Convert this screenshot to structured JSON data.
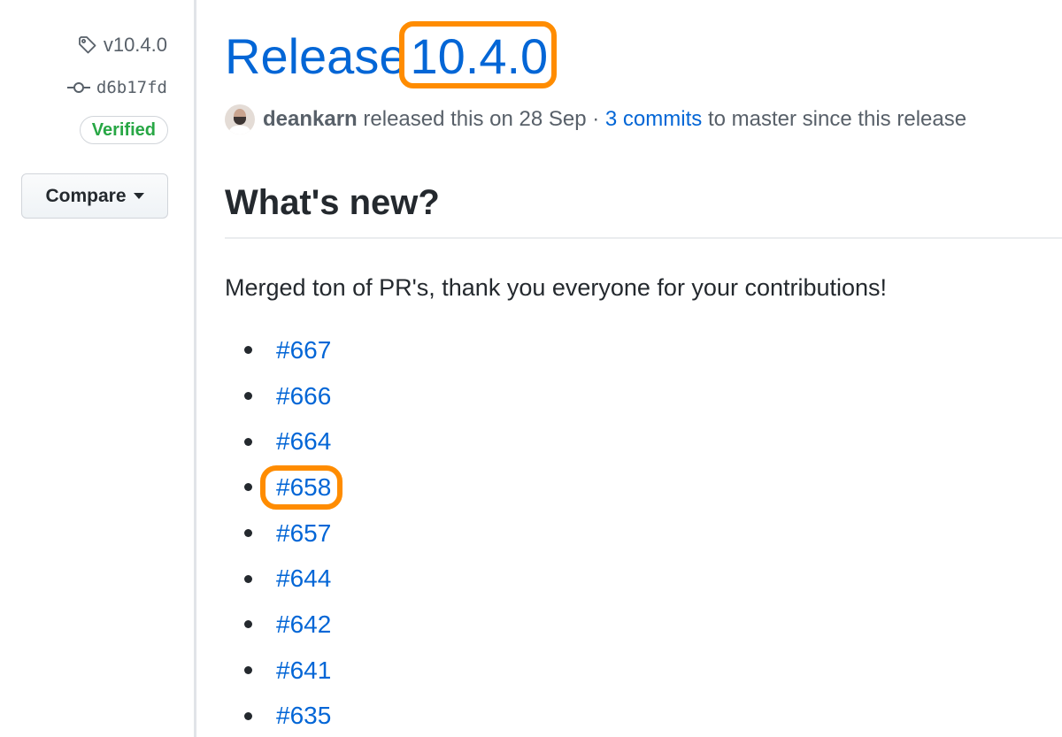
{
  "sidebar": {
    "tag": "v10.4.0",
    "commit": "d6b17fd",
    "verified_label": "Verified",
    "compare_label": "Compare"
  },
  "release": {
    "title_prefix": "Release",
    "version": "10.4.0",
    "author": "deankarn",
    "released_text": "released this on 28 Sep ·",
    "commits_link": "3 commits",
    "commits_suffix": "to master since this release"
  },
  "body": {
    "heading": "What's new?",
    "intro": "Merged ton of PR's, thank you everyone for your contributions!",
    "pr_links": [
      "#667",
      "#666",
      "#664",
      "#658",
      "#657",
      "#644",
      "#642",
      "#641",
      "#635"
    ]
  },
  "highlight_color": "#ff8c00",
  "link_color": "#0366d6",
  "icons": [
    "tag-icon",
    "git-commit-icon",
    "caret-down-icon"
  ]
}
